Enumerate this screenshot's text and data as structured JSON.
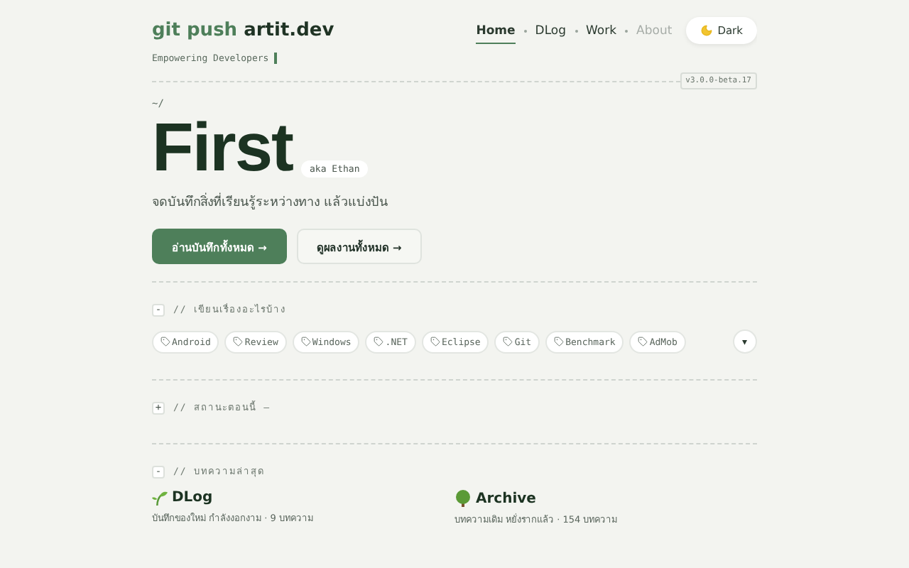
{
  "brand": {
    "prefix": "git push",
    "name": "artit.dev",
    "tagline": "Empowering Developers"
  },
  "nav": [
    {
      "label": "Home",
      "selected": true,
      "disabled": false
    },
    {
      "label": "DLog",
      "selected": false,
      "disabled": false
    },
    {
      "label": "Work",
      "selected": false,
      "disabled": false
    },
    {
      "label": "About",
      "selected": false,
      "disabled": true
    }
  ],
  "theme_button": {
    "label": "Dark"
  },
  "version": "v3.0.0-beta.17",
  "path": "~/",
  "hero": {
    "title": "First",
    "alias": "aka Ethan",
    "subtitle": "จดบันทึกสิ่งที่เรียนรู้ระหว่างทาง แล้วแบ่งปัน",
    "buttons": [
      {
        "label": "อ่านบันทึกทั้งหมด →",
        "kind": "primary"
      },
      {
        "label": "ดูผลงานทั้งหมด →",
        "kind": "secondary"
      }
    ]
  },
  "sections": [
    {
      "toggle": "-",
      "heading": "// เขียนเรื่องอะไรบ้าง",
      "kind": "tags",
      "tags": [
        "Android",
        "Review",
        "Windows",
        ".NET",
        "Eclipse",
        "Git",
        "Benchmark",
        "AdMob"
      ],
      "more": "▾"
    },
    {
      "toggle": "+",
      "heading": "// สถานะตอนนี้ —",
      "kind": "status"
    },
    {
      "toggle": "-",
      "heading": "// บทความล่าสุด",
      "kind": "cards",
      "cards": [
        {
          "title": "DLog",
          "meta": "บันทึกของใหม่ กำลังงอกงาม · 9 บทความ"
        },
        {
          "title": "Archive",
          "meta": "บทความเดิม หยั่งรากแล้ว · 154 บทความ"
        }
      ]
    }
  ]
}
